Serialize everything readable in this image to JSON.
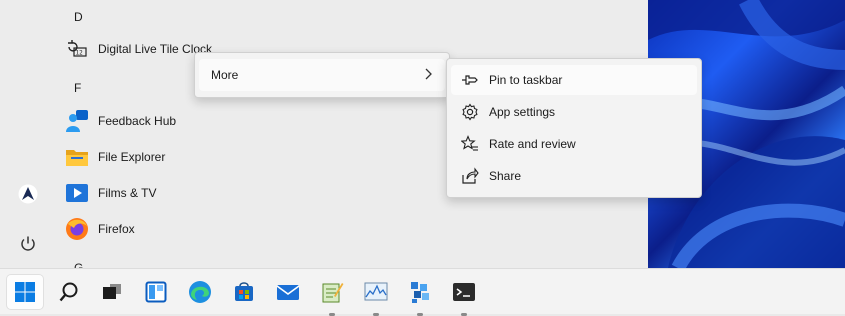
{
  "start_menu": {
    "sections": [
      {
        "letter": "D",
        "apps": [
          {
            "label": "Digital Live Tile Clock",
            "icon": "clock-icon"
          }
        ]
      },
      {
        "letter": "F",
        "apps": [
          {
            "label": "Feedback Hub",
            "icon": "feedback-hub-icon"
          },
          {
            "label": "File Explorer",
            "icon": "folder-icon"
          },
          {
            "label": "Films & TV",
            "icon": "films-tv-icon"
          },
          {
            "label": "Firefox",
            "icon": "firefox-icon"
          }
        ]
      }
    ],
    "partial_letter": "G"
  },
  "rail": {
    "user_icon": "account-icon",
    "power_icon": "power-icon"
  },
  "context_menu": {
    "more": {
      "label": "More",
      "chevron": "chevron-right-icon"
    },
    "submenu": [
      {
        "label": "Pin to taskbar",
        "icon": "pin-icon"
      },
      {
        "label": "App settings",
        "icon": "gear-icon"
      },
      {
        "label": "Rate and review",
        "icon": "star-icon"
      },
      {
        "label": "Share",
        "icon": "share-icon"
      }
    ]
  },
  "taskbar": {
    "items": [
      {
        "name": "start",
        "icon": "windows-icon",
        "active": true,
        "running": false
      },
      {
        "name": "search",
        "icon": "search-icon",
        "running": false
      },
      {
        "name": "task-view",
        "icon": "task-view-icon",
        "running": false
      },
      {
        "name": "widgets",
        "icon": "widgets-icon",
        "running": false
      },
      {
        "name": "edge",
        "icon": "edge-icon",
        "running": false
      },
      {
        "name": "store",
        "icon": "store-icon",
        "running": false
      },
      {
        "name": "mail",
        "icon": "mail-icon",
        "running": false
      },
      {
        "name": "notepad",
        "icon": "notepad-icon",
        "running": true
      },
      {
        "name": "performance-monitor",
        "icon": "chart-icon",
        "running": true
      },
      {
        "name": "blocks-app",
        "icon": "blocks-icon",
        "running": true
      },
      {
        "name": "terminal",
        "icon": "terminal-icon",
        "running": true
      }
    ]
  },
  "colors": {
    "accent": "#0067c0",
    "menu_bg": "#f3f3f3",
    "wallpaper": "#1f5cf2"
  }
}
